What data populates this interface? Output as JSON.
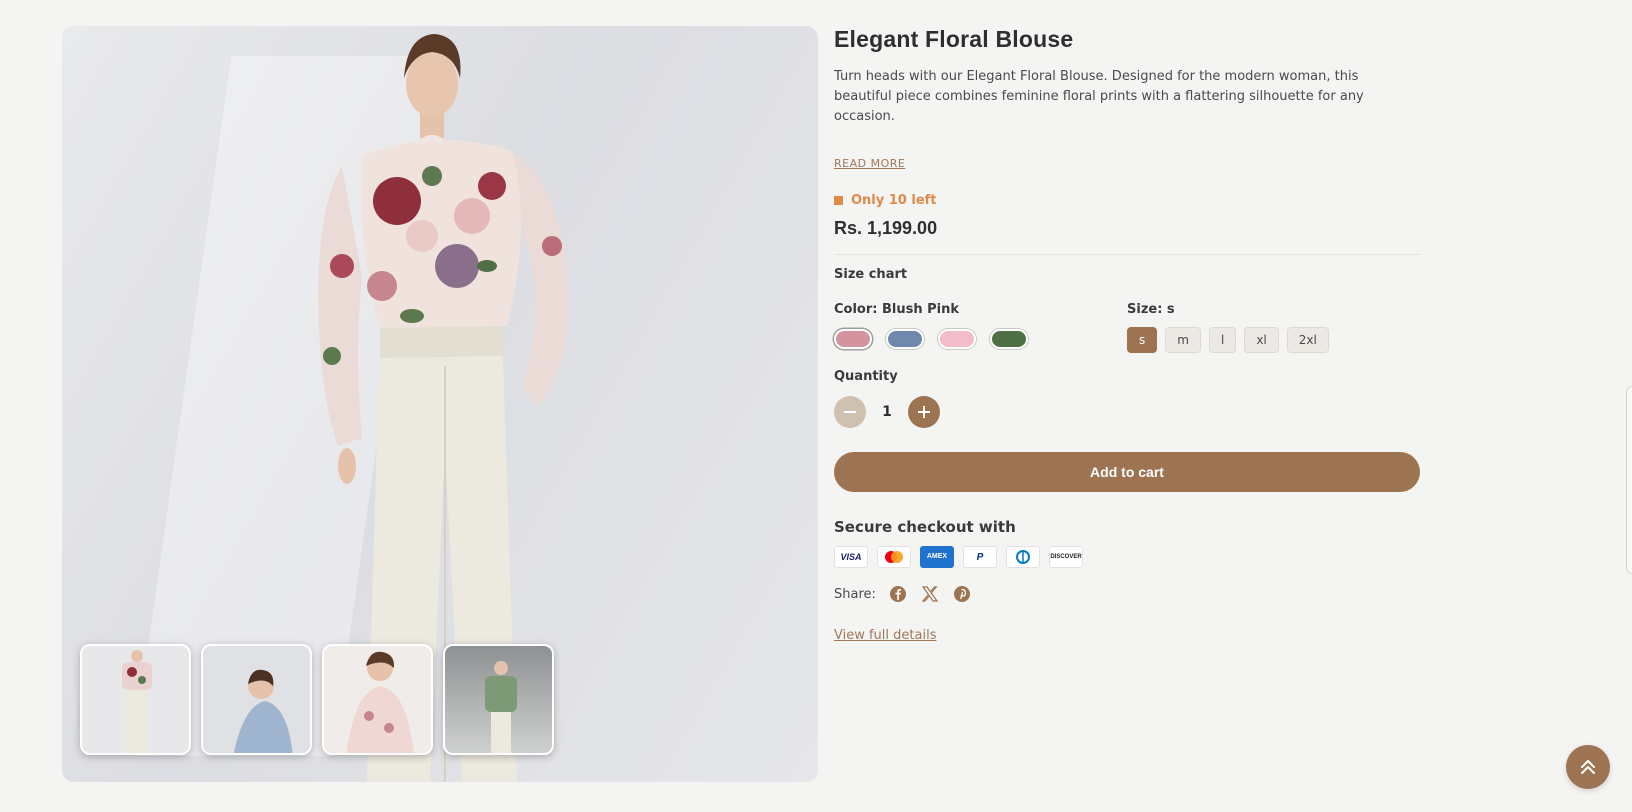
{
  "product": {
    "title": "Elegant Floral Blouse",
    "description": "Turn heads with our Elegant Floral Blouse. Designed for the modern woman, this beautiful piece combines feminine floral prints with a flattering silhouette for any occasion.",
    "read_more": "READ MORE",
    "stock": "Only 10 left",
    "price": "Rs. 1,199.00",
    "size_chart": "Size chart"
  },
  "color": {
    "label": "Color: Blush Pink",
    "swatches": [
      {
        "name": "Blush Pink",
        "hex": "#d4949f",
        "selected": true
      },
      {
        "name": "Blue",
        "hex": "#6f88ab",
        "selected": false
      },
      {
        "name": "Pink",
        "hex": "#f2bccb",
        "selected": false
      },
      {
        "name": "Green",
        "hex": "#4f7044",
        "selected": false
      }
    ]
  },
  "size": {
    "label": "Size: s",
    "options": [
      "s",
      "m",
      "l",
      "xl",
      "2xl"
    ],
    "selected": "s"
  },
  "quantity": {
    "label": "Quantity",
    "value": "1"
  },
  "cart": {
    "add_label": "Add to cart"
  },
  "checkout": {
    "label": "Secure checkout with",
    "payments": [
      "VISA",
      "Mastercard",
      "AMEX",
      "PayPal",
      "Diners Club",
      "DISCOVER"
    ]
  },
  "share": {
    "label": "Share:",
    "networks": [
      "facebook-icon",
      "x-icon",
      "pinterest-icon"
    ]
  },
  "links": {
    "view_full": "View full details"
  },
  "colors": {
    "accent": "#9d7451",
    "stock": "#e08a4a",
    "link": "#a0785a"
  }
}
